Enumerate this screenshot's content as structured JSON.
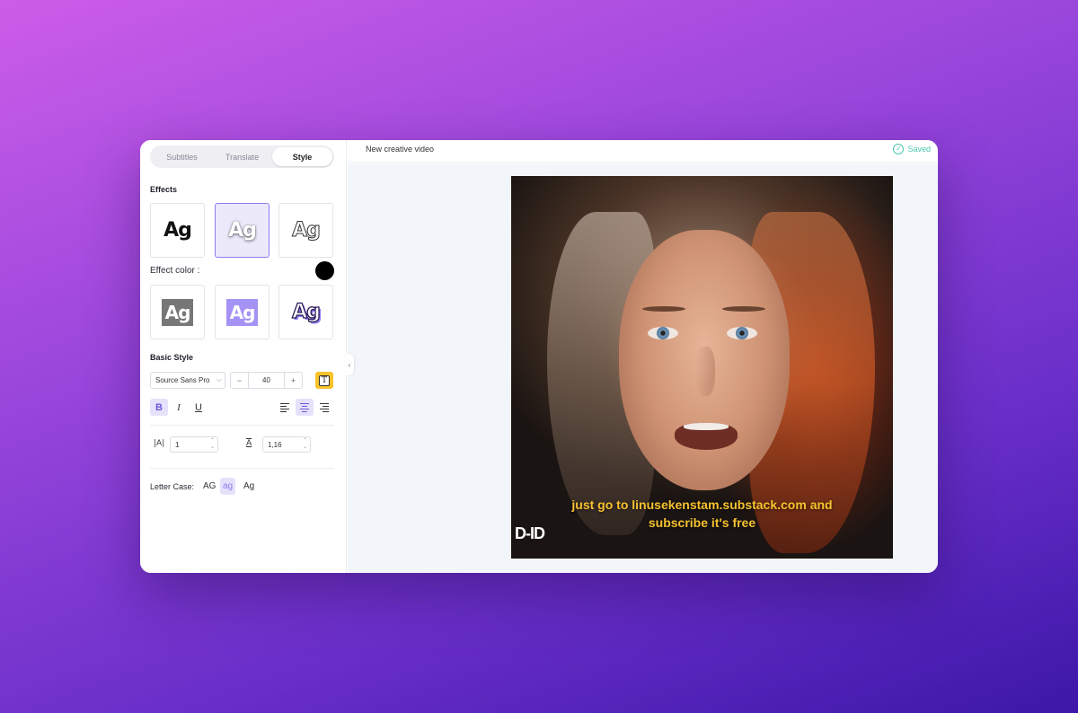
{
  "panel": {
    "tabs": [
      {
        "label": "Subtitles"
      },
      {
        "label": "Translate"
      },
      {
        "label": "Style"
      }
    ],
    "effects_title": "Effects",
    "effect_tile_text": "Ag",
    "effect_color_label": "Effect color :",
    "effect_color": "#000000",
    "basic_style_title": "Basic Style",
    "font_family": "Source Sans Pro",
    "font_size": "40",
    "font_size_minus": "−",
    "font_size_plus": "+",
    "format": {
      "bold": "B",
      "italic": "I",
      "underline": "U"
    },
    "letter_spacing": "1",
    "line_height": "1,16",
    "letter_case_label": "Letter Case:",
    "letter_case_options": [
      "AG",
      "ag",
      "Ag"
    ]
  },
  "header": {
    "title": "New creative video",
    "saved": "Saved"
  },
  "video": {
    "subtitle_line1": "just go to linusekenstam.substack.com and",
    "subtitle_line2": "subscribe it's free",
    "watermark": "D-ID"
  },
  "colors": {
    "accent": "#8d7cf2",
    "subtitle": "#f6c230",
    "saved": "#4cc9b0",
    "text_color_button": "#f8c22a"
  }
}
